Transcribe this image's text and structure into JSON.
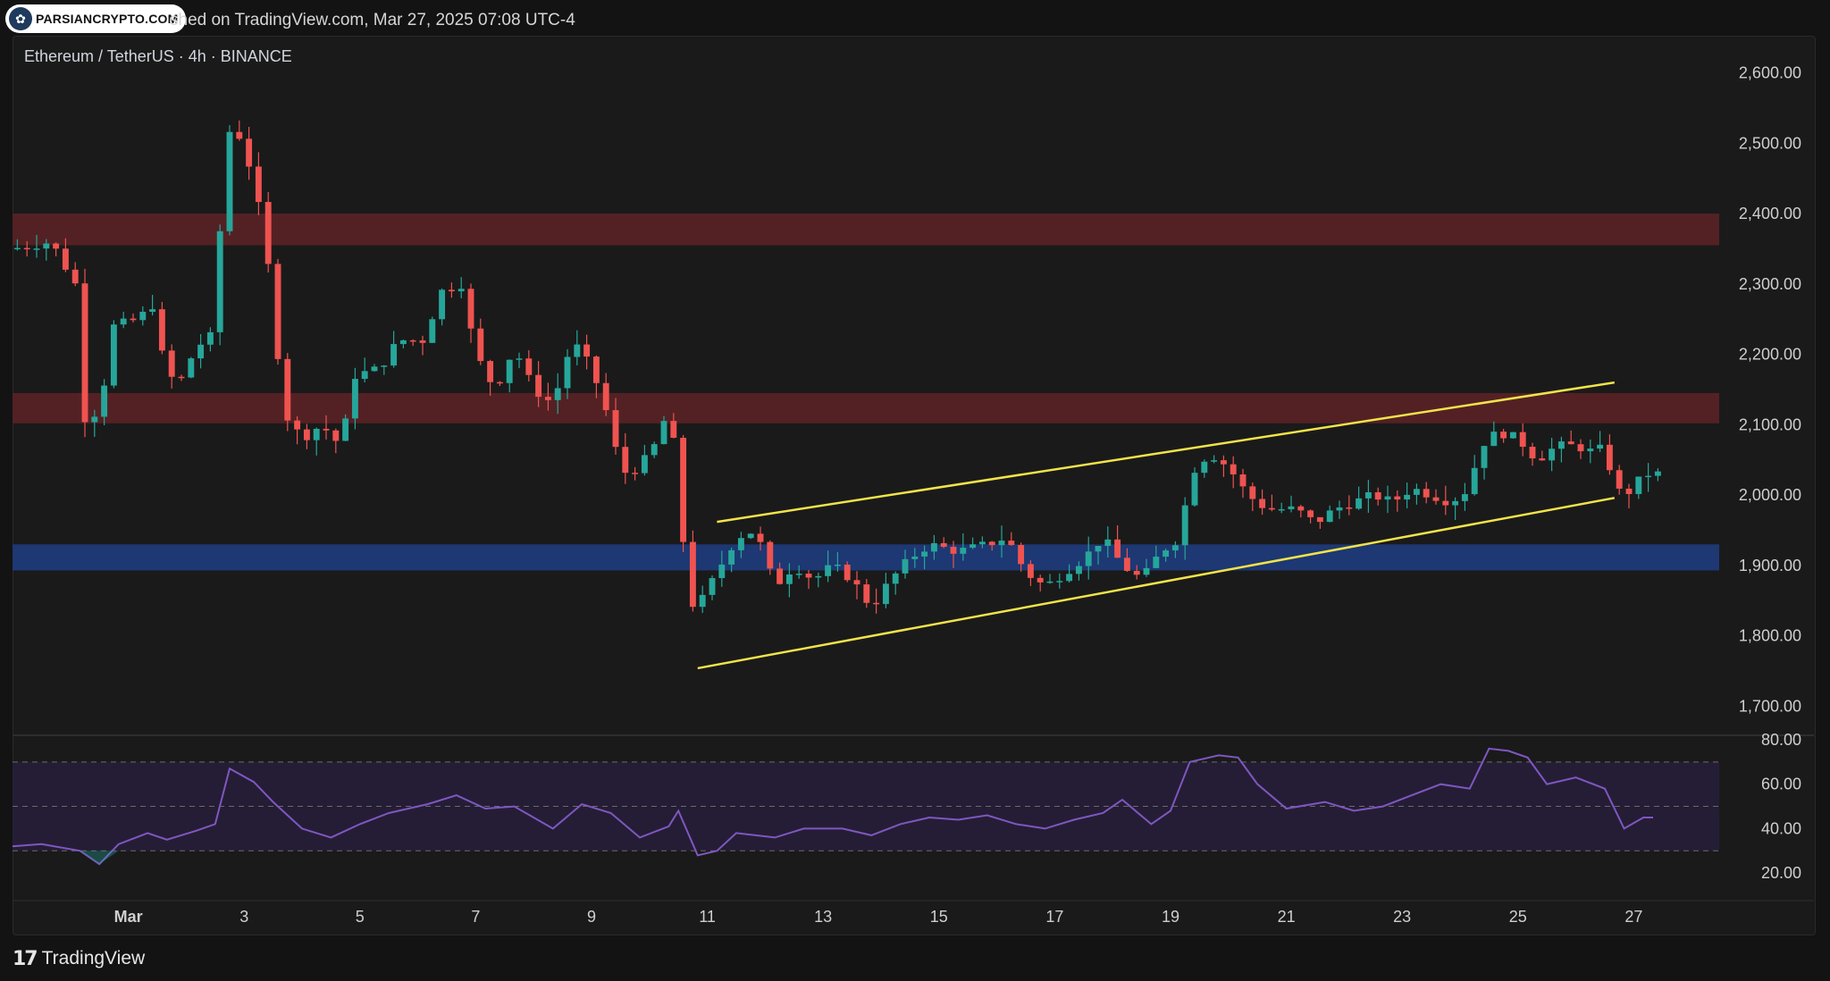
{
  "header": {
    "watermark_logo_text": "PARSIANCRYPTO.COM",
    "published_text": "shed on TradingView.com, Mar 27, 2025 07:08 UTC-4"
  },
  "chart_header": {
    "symbol_text": "Ethereum / TetherUS · 4h · BINANCE"
  },
  "footer": {
    "brand_mark": "17",
    "brand_text": "TradingView"
  },
  "colors": {
    "up": "#26a69a",
    "down": "#ef5350",
    "resistance_zone": "#5a2226",
    "support_zone": "#1d3a78",
    "channel": "#f2e34a",
    "rsi_line": "#7e57c2",
    "rsi_band": "#271e38"
  },
  "chart_data": [
    {
      "type": "candlestick",
      "title": "Ethereum / TetherUS · 4h · BINANCE",
      "x_axis": {
        "start": "2025-02-27T00:00",
        "end": "2025-03-27T08:00",
        "ticks": [
          {
            "date": "2025-03-01",
            "label": "Mar"
          },
          {
            "date": "2025-03-03",
            "label": "3"
          },
          {
            "date": "2025-03-05",
            "label": "5"
          },
          {
            "date": "2025-03-07",
            "label": "7"
          },
          {
            "date": "2025-03-09",
            "label": "9"
          },
          {
            "date": "2025-03-11",
            "label": "11"
          },
          {
            "date": "2025-03-13",
            "label": "13"
          },
          {
            "date": "2025-03-15",
            "label": "15"
          },
          {
            "date": "2025-03-17",
            "label": "17"
          },
          {
            "date": "2025-03-19",
            "label": "19"
          },
          {
            "date": "2025-03-21",
            "label": "21"
          },
          {
            "date": "2025-03-23",
            "label": "23"
          },
          {
            "date": "2025-03-25",
            "label": "25"
          },
          {
            "date": "2025-03-27",
            "label": "27"
          }
        ]
      },
      "y_axis": {
        "range": [
          1660,
          2640
        ],
        "ticks": [
          {
            "value": 2600,
            "label": "2,600.00"
          },
          {
            "value": 2500,
            "label": "2,500.00"
          },
          {
            "value": 2400,
            "label": "2,400.00"
          },
          {
            "value": 2300,
            "label": "2,300.00"
          },
          {
            "value": 2200,
            "label": "2,200.00"
          },
          {
            "value": 2100,
            "label": "2,100.00"
          },
          {
            "value": 2000,
            "label": "2,000.00"
          },
          {
            "value": 1900,
            "label": "1,900.00"
          },
          {
            "value": 1800,
            "label": "1,800.00"
          },
          {
            "value": 1700,
            "label": "1,700.00"
          }
        ]
      },
      "price_path": [
        [
          "2025-02-27T00:00",
          2350
        ],
        [
          "2025-02-27T16:00",
          2360
        ],
        [
          "2025-02-28T02:00",
          2300
        ],
        [
          "2025-02-28T06:00",
          2110
        ],
        [
          "2025-02-28T12:00",
          2120
        ],
        [
          "2025-02-28T18:00",
          2240
        ],
        [
          "2025-03-01T04:00",
          2250
        ],
        [
          "2025-03-01T10:00",
          2270
        ],
        [
          "2025-03-01T14:00",
          2200
        ],
        [
          "2025-03-01T20:00",
          2150
        ],
        [
          "2025-03-02T04:00",
          2210
        ],
        [
          "2025-03-02T12:00",
          2230
        ],
        [
          "2025-03-02T16:00",
          2520
        ],
        [
          "2025-03-02T22:00",
          2510
        ],
        [
          "2025-03-03T04:00",
          2450
        ],
        [
          "2025-03-03T08:00",
          2370
        ],
        [
          "2025-03-03T12:00",
          2280
        ],
        [
          "2025-03-03T16:00",
          2120
        ],
        [
          "2025-03-04T00:00",
          2080
        ],
        [
          "2025-03-04T08:00",
          2100
        ],
        [
          "2025-03-04T16:00",
          2070
        ],
        [
          "2025-03-04T22:00",
          2170
        ],
        [
          "2025-03-05T08:00",
          2180
        ],
        [
          "2025-03-05T16:00",
          2220
        ],
        [
          "2025-03-06T02:00",
          2220
        ],
        [
          "2025-03-06T10:00",
          2290
        ],
        [
          "2025-03-06T18:00",
          2300
        ],
        [
          "2025-03-07T00:00",
          2200
        ],
        [
          "2025-03-07T08:00",
          2150
        ],
        [
          "2025-03-07T16:00",
          2210
        ],
        [
          "2025-03-08T00:00",
          2150
        ],
        [
          "2025-03-08T08:00",
          2130
        ],
        [
          "2025-03-08T16:00",
          2220
        ],
        [
          "2025-03-09T00:00",
          2180
        ],
        [
          "2025-03-09T08:00",
          2100
        ],
        [
          "2025-03-09T12:00",
          2030
        ],
        [
          "2025-03-09T20:00",
          2040
        ],
        [
          "2025-03-10T04:00",
          2080
        ],
        [
          "2025-03-10T08:00",
          2130
        ],
        [
          "2025-03-10T12:00",
          2020
        ],
        [
          "2025-03-10T16:00",
          1850
        ],
        [
          "2025-03-10T20:00",
          1840
        ],
        [
          "2025-03-11T04:00",
          1890
        ],
        [
          "2025-03-11T12:00",
          1940
        ],
        [
          "2025-03-11T20:00",
          1950
        ],
        [
          "2025-03-12T04:00",
          1870
        ],
        [
          "2025-03-12T12:00",
          1900
        ],
        [
          "2025-03-12T20:00",
          1880
        ],
        [
          "2025-03-13T04:00",
          1900
        ],
        [
          "2025-03-13T12:00",
          1880
        ],
        [
          "2025-03-13T20:00",
          1840
        ],
        [
          "2025-03-14T04:00",
          1880
        ],
        [
          "2025-03-14T12:00",
          1910
        ],
        [
          "2025-03-14T20:00",
          1930
        ],
        [
          "2025-03-15T08:00",
          1920
        ],
        [
          "2025-03-15T20:00",
          1930
        ],
        [
          "2025-03-16T04:00",
          1940
        ],
        [
          "2025-03-16T12:00",
          1890
        ],
        [
          "2025-03-16T20:00",
          1870
        ],
        [
          "2025-03-17T04:00",
          1890
        ],
        [
          "2025-03-17T12:00",
          1910
        ],
        [
          "2025-03-17T20:00",
          1940
        ],
        [
          "2025-03-18T04:00",
          1900
        ],
        [
          "2025-03-18T12:00",
          1880
        ],
        [
          "2025-03-18T20:00",
          1920
        ],
        [
          "2025-03-19T04:00",
          1940
        ],
        [
          "2025-03-19T08:00",
          2030
        ],
        [
          "2025-03-19T16:00",
          2060
        ],
        [
          "2025-03-20T00:00",
          2040
        ],
        [
          "2025-03-20T08:00",
          2000
        ],
        [
          "2025-03-20T16:00",
          1980
        ],
        [
          "2025-03-21T04:00",
          1980
        ],
        [
          "2025-03-21T12:00",
          1960
        ],
        [
          "2025-03-21T20:00",
          1980
        ],
        [
          "2025-03-22T04:00",
          1990
        ],
        [
          "2025-03-22T12:00",
          2000
        ],
        [
          "2025-03-22T20:00",
          1990
        ],
        [
          "2025-03-23T04:00",
          2010
        ],
        [
          "2025-03-23T12:00",
          2000
        ],
        [
          "2025-03-23T20:00",
          1990
        ],
        [
          "2025-03-24T04:00",
          2010
        ],
        [
          "2025-03-24T08:00",
          2070
        ],
        [
          "2025-03-24T16:00",
          2090
        ],
        [
          "2025-03-25T00:00",
          2080
        ],
        [
          "2025-03-25T08:00",
          2050
        ],
        [
          "2025-03-25T16:00",
          2070
        ],
        [
          "2025-03-26T00:00",
          2070
        ],
        [
          "2025-03-26T08:00",
          2060
        ],
        [
          "2025-03-26T12:00",
          2070
        ],
        [
          "2025-03-26T16:00",
          2010
        ],
        [
          "2025-03-26T20:00",
          2000
        ],
        [
          "2025-03-27T00:00",
          2010
        ],
        [
          "2025-03-27T04:00",
          2030
        ],
        [
          "2025-03-27T08:00",
          2030
        ]
      ],
      "zones": [
        {
          "name": "upper-resistance",
          "from": 2355,
          "to": 2400,
          "color": "resistance_zone"
        },
        {
          "name": "lower-resistance",
          "from": 2102,
          "to": 2145,
          "color": "resistance_zone"
        },
        {
          "name": "support",
          "from": 1893,
          "to": 1930,
          "color": "support_zone"
        }
      ],
      "channel": {
        "upper": [
          [
            "2025-03-11T04:00",
            1962
          ],
          [
            "2025-03-26T16:00",
            2160
          ]
        ],
        "lower": [
          [
            "2025-03-10T20:00",
            1754
          ],
          [
            "2025-03-26T16:00",
            1996
          ]
        ]
      }
    },
    {
      "type": "line",
      "indicator": "RSI",
      "y_axis": {
        "range": [
          10,
          82
        ],
        "ticks": [
          {
            "value": 80,
            "label": "80.00"
          },
          {
            "value": 60,
            "label": "60.00"
          },
          {
            "value": 40,
            "label": "40.00"
          },
          {
            "value": 20,
            "label": "20.00"
          }
        ]
      },
      "band": [
        30,
        70
      ],
      "midline": 50,
      "series": [
        [
          "2025-02-27T00:00",
          32
        ],
        [
          "2025-02-27T12:00",
          33
        ],
        [
          "2025-02-28T04:00",
          30
        ],
        [
          "2025-02-28T12:00",
          24
        ],
        [
          "2025-02-28T20:00",
          33
        ],
        [
          "2025-03-01T08:00",
          38
        ],
        [
          "2025-03-01T16:00",
          35
        ],
        [
          "2025-03-02T04:00",
          39
        ],
        [
          "2025-03-02T12:00",
          42
        ],
        [
          "2025-03-02T18:00",
          67
        ],
        [
          "2025-03-03T04:00",
          61
        ],
        [
          "2025-03-03T12:00",
          52
        ],
        [
          "2025-03-04T00:00",
          40
        ],
        [
          "2025-03-04T12:00",
          36
        ],
        [
          "2025-03-05T00:00",
          42
        ],
        [
          "2025-03-05T12:00",
          47
        ],
        [
          "2025-03-06T04:00",
          51
        ],
        [
          "2025-03-06T16:00",
          55
        ],
        [
          "2025-03-07T04:00",
          49
        ],
        [
          "2025-03-07T16:00",
          50
        ],
        [
          "2025-03-08T08:00",
          40
        ],
        [
          "2025-03-08T20:00",
          51
        ],
        [
          "2025-03-09T08:00",
          47
        ],
        [
          "2025-03-09T20:00",
          36
        ],
        [
          "2025-03-10T08:00",
          41
        ],
        [
          "2025-03-10T12:00",
          48
        ],
        [
          "2025-03-10T20:00",
          28
        ],
        [
          "2025-03-11T04:00",
          30
        ],
        [
          "2025-03-11T12:00",
          38
        ],
        [
          "2025-03-12T04:00",
          36
        ],
        [
          "2025-03-12T16:00",
          40
        ],
        [
          "2025-03-13T08:00",
          40
        ],
        [
          "2025-03-13T20:00",
          37
        ],
        [
          "2025-03-14T08:00",
          42
        ],
        [
          "2025-03-14T20:00",
          45
        ],
        [
          "2025-03-15T08:00",
          44
        ],
        [
          "2025-03-15T20:00",
          46
        ],
        [
          "2025-03-16T08:00",
          42
        ],
        [
          "2025-03-16T20:00",
          40
        ],
        [
          "2025-03-17T08:00",
          44
        ],
        [
          "2025-03-17T20:00",
          47
        ],
        [
          "2025-03-18T04:00",
          53
        ],
        [
          "2025-03-18T16:00",
          42
        ],
        [
          "2025-03-19T00:00",
          48
        ],
        [
          "2025-03-19T08:00",
          70
        ],
        [
          "2025-03-19T20:00",
          73
        ],
        [
          "2025-03-20T04:00",
          72
        ],
        [
          "2025-03-20T12:00",
          60
        ],
        [
          "2025-03-21T00:00",
          49
        ],
        [
          "2025-03-21T16:00",
          52
        ],
        [
          "2025-03-22T04:00",
          48
        ],
        [
          "2025-03-22T16:00",
          50
        ],
        [
          "2025-03-23T04:00",
          55
        ],
        [
          "2025-03-23T16:00",
          60
        ],
        [
          "2025-03-24T04:00",
          58
        ],
        [
          "2025-03-24T12:00",
          76
        ],
        [
          "2025-03-24T20:00",
          75
        ],
        [
          "2025-03-25T04:00",
          72
        ],
        [
          "2025-03-25T12:00",
          60
        ],
        [
          "2025-03-26T00:00",
          63
        ],
        [
          "2025-03-26T12:00",
          58
        ],
        [
          "2025-03-26T20:00",
          40
        ],
        [
          "2025-03-27T04:00",
          45
        ],
        [
          "2025-03-27T08:00",
          45
        ]
      ]
    }
  ]
}
